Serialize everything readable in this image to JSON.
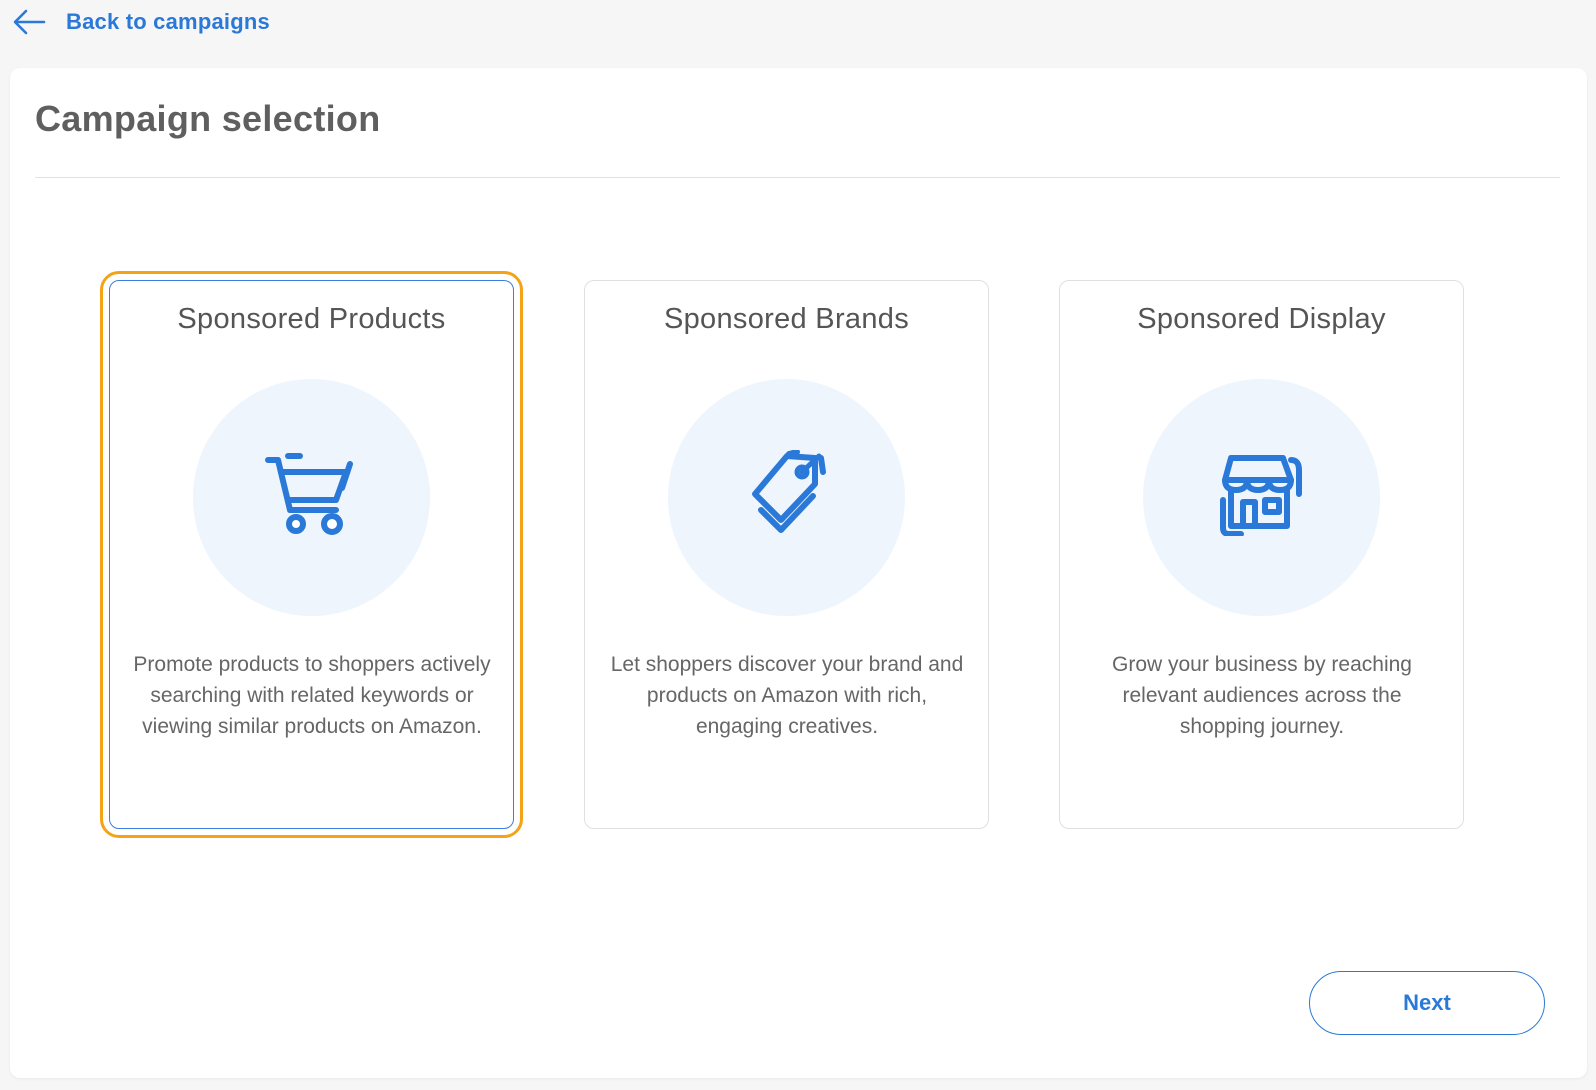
{
  "nav": {
    "back_label": "Back to campaigns",
    "back_icon": "arrow-left-icon"
  },
  "page": {
    "title": "Campaign selection"
  },
  "cards": [
    {
      "title": "Sponsored Products",
      "icon": "shopping-cart-icon",
      "description": "Promote products to shoppers actively searching with related keywords or viewing similar products on Amazon.",
      "selected": true
    },
    {
      "title": "Sponsored Brands",
      "icon": "price-tag-icon",
      "description": "Let shoppers discover your brand and products on Amazon with rich, engaging creatives.",
      "selected": false
    },
    {
      "title": "Sponsored Display",
      "icon": "storefront-icon",
      "description": "Grow your business by reaching relevant audiences across the shopping journey.",
      "selected": false
    }
  ],
  "footer": {
    "next_label": "Next"
  },
  "colors": {
    "accent": "#2a79d8",
    "selected_outline": "#f5a315",
    "icon_background": "#eef5fd",
    "page_background": "#f6f6f6"
  }
}
